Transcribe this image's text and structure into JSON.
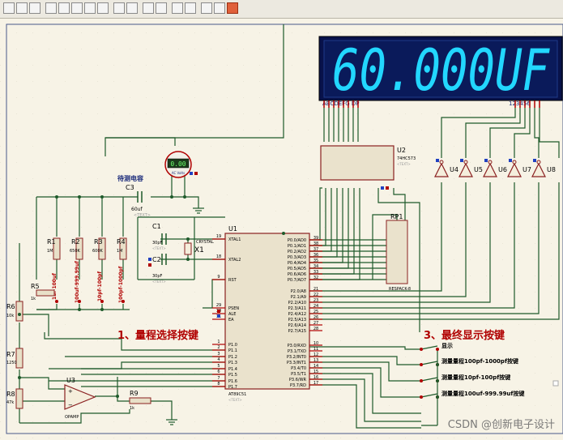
{
  "display": {
    "reading": "60.000UF",
    "segment_labels": "ABCDEFG DP",
    "digit_labels": "123456"
  },
  "meter": {
    "reading": "0.00",
    "unit": "AC Volts"
  },
  "cap_under_test": {
    "title": "待测电容",
    "ref": "C3",
    "value": "60uf",
    "text": "<TEXT>"
  },
  "latch": {
    "ref": "U2",
    "part": "74HC573",
    "text": "<TEXT>"
  },
  "resistor_pack": {
    "ref": "RP1",
    "part": "RESPACK-8"
  },
  "mcu": {
    "ref": "U1",
    "part": "AT89C51",
    "text": "<TEXT>",
    "left_pins": [
      {
        "num": "19",
        "name": "XTAL1"
      },
      {
        "num": "18",
        "name": "XTAL2"
      },
      {
        "num": "9",
        "name": "RST"
      },
      {
        "num": "29",
        "name": "PSEN"
      },
      {
        "num": "30",
        "name": "ALE"
      },
      {
        "num": "31",
        "name": "EA"
      },
      {
        "num": "1",
        "name": "P1.0"
      },
      {
        "num": "2",
        "name": "P1.1"
      },
      {
        "num": "3",
        "name": "P1.2"
      },
      {
        "num": "4",
        "name": "P1.3"
      },
      {
        "num": "5",
        "name": "P1.4"
      },
      {
        "num": "6",
        "name": "P1.5"
      },
      {
        "num": "7",
        "name": "P1.6"
      },
      {
        "num": "8",
        "name": "P1.7"
      }
    ],
    "right_pins": [
      {
        "num": "39",
        "name": "P0.0/AD0"
      },
      {
        "num": "38",
        "name": "P0.1/AD1"
      },
      {
        "num": "37",
        "name": "P0.2/AD2"
      },
      {
        "num": "36",
        "name": "P0.3/AD3"
      },
      {
        "num": "35",
        "name": "P0.4/AD4"
      },
      {
        "num": "34",
        "name": "P0.5/AD5"
      },
      {
        "num": "33",
        "name": "P0.6/AD6"
      },
      {
        "num": "32",
        "name": "P0.7/AD7"
      },
      {
        "num": "21",
        "name": "P2.0/A8"
      },
      {
        "num": "22",
        "name": "P2.1/A9"
      },
      {
        "num": "23",
        "name": "P2.2/A10"
      },
      {
        "num": "24",
        "name": "P2.3/A11"
      },
      {
        "num": "25",
        "name": "P2.4/A12"
      },
      {
        "num": "26",
        "name": "P2.5/A13"
      },
      {
        "num": "27",
        "name": "P2.6/A14"
      },
      {
        "num": "28",
        "name": "P2.7/A15"
      },
      {
        "num": "10",
        "name": "P3.0/RXD"
      },
      {
        "num": "11",
        "name": "P3.1/TXD"
      },
      {
        "num": "12",
        "name": "P3.2/INT0"
      },
      {
        "num": "13",
        "name": "P3.3/INT1"
      },
      {
        "num": "14",
        "name": "P3.4/T0"
      },
      {
        "num": "15",
        "name": "P3.5/T1"
      },
      {
        "num": "16",
        "name": "P3.6/WR"
      },
      {
        "num": "17",
        "name": "P3.7/RD"
      }
    ]
  },
  "crystal": {
    "ref": "X1",
    "part": "CRYSTAL"
  },
  "c1": {
    "ref": "C1",
    "value": "30pF",
    "text": "<TEXT>"
  },
  "c2": {
    "ref": "C2",
    "value": "30pF",
    "text": "<TEXT>"
  },
  "resistors": [
    {
      "ref": "R1",
      "value": "1M"
    },
    {
      "ref": "R2",
      "value": "650K"
    },
    {
      "ref": "R3",
      "value": "600K"
    },
    {
      "ref": "R4",
      "value": "1M"
    }
  ],
  "range_switch_labels": [
    "1uf-100uf",
    "100uf-999.99uf",
    "10pf-100pf",
    "100pf-1000pf"
  ],
  "left_resistors": [
    {
      "ref": "R5",
      "value": "1k"
    },
    {
      "ref": "R6",
      "value": "10k"
    },
    {
      "ref": "R7",
      "value": "1250"
    },
    {
      "ref": "R8",
      "value": "47k"
    }
  ],
  "opamp": {
    "ref": "U3",
    "part": "OPAMP"
  },
  "r9": {
    "ref": "R9",
    "value": "1k"
  },
  "inverters": [
    "U4",
    "U5",
    "U6",
    "U7",
    "U8"
  ],
  "annotations": {
    "range_select": "1、量程选择按键",
    "final_display": "3、最终显示按键"
  },
  "right_buttons": [
    "显示",
    "测量量程100pf-1000pf按键",
    "测量量程10pf-100pf按键",
    "测量量程100uf-999.99uf按键"
  ],
  "watermark": "CSDN @创新电子设计"
}
